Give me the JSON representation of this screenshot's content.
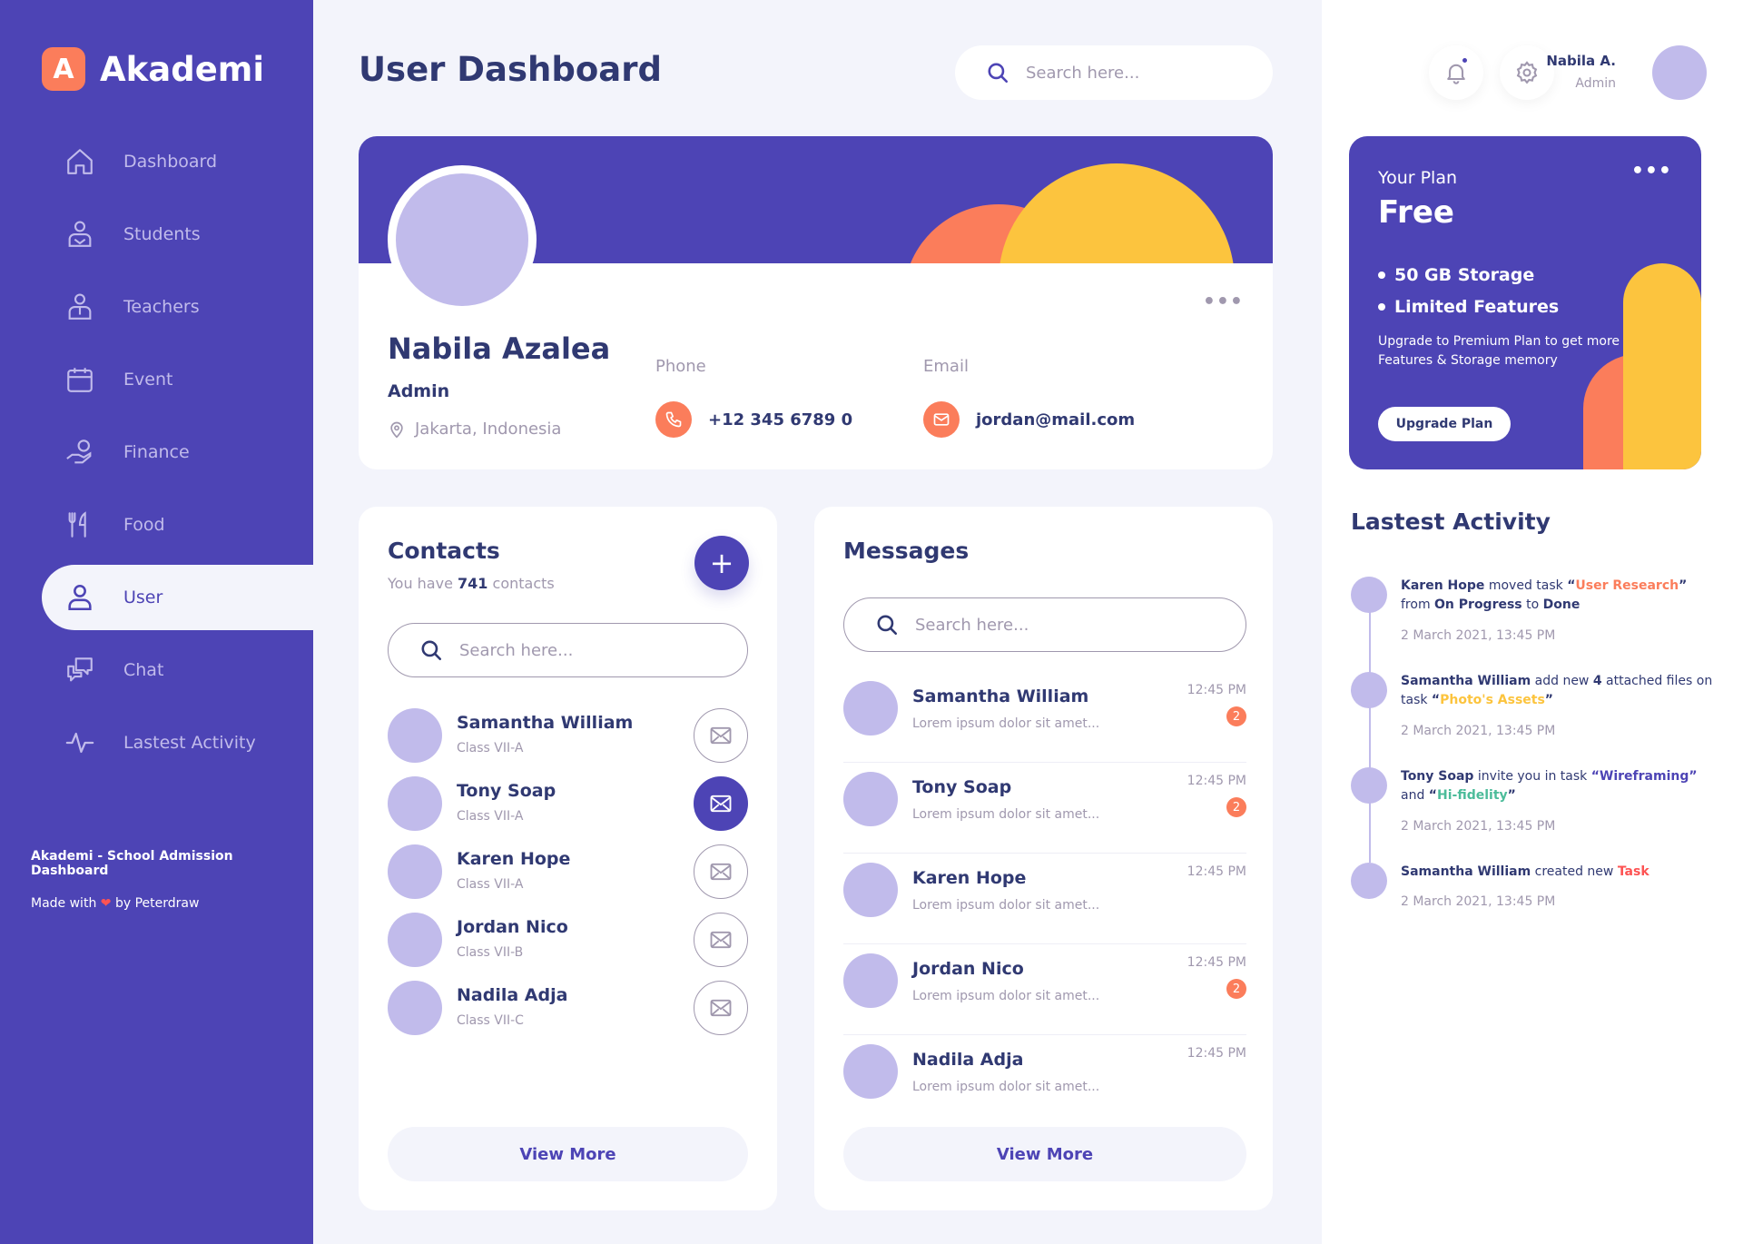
{
  "brand": {
    "badge": "A",
    "name": "Akademi",
    "colors": {
      "primary": "#4d44b5",
      "orange": "#fb7d5b",
      "yellow": "#fcc43e",
      "lavender": "#c1bbeb",
      "green": "#4cbc9a",
      "red": "#fd5353"
    }
  },
  "sidebar": {
    "items": [
      {
        "label": "Dashboard",
        "icon": "home-icon"
      },
      {
        "label": "Students",
        "icon": "student-icon"
      },
      {
        "label": "Teachers",
        "icon": "teacher-icon"
      },
      {
        "label": "Event",
        "icon": "calendar-icon"
      },
      {
        "label": "Finance",
        "icon": "finance-icon"
      },
      {
        "label": "Food",
        "icon": "food-icon"
      },
      {
        "label": "User",
        "icon": "user-icon",
        "active": true
      },
      {
        "label": "Chat",
        "icon": "chat-icon"
      },
      {
        "label": "Lastest Activity",
        "icon": "activity-icon"
      }
    ],
    "footer": {
      "title": "Akademi - School Admission Dashboard",
      "made_with": "Made with",
      "by": "by Peterdraw"
    }
  },
  "header": {
    "title": "User Dashboard",
    "search_placeholder": "Search here..."
  },
  "profile": {
    "name": "Nabila Azalea",
    "role": "Admin",
    "location": "Jakarta, Indonesia",
    "phone_label": "Phone",
    "phone": "+12 345 6789 0",
    "email_label": "Email",
    "email": "jordan@mail.com",
    "menu": "•••"
  },
  "contacts": {
    "title": "Contacts",
    "subtitle_pre": "You have",
    "count": "741",
    "subtitle_post": "contacts",
    "add": "+",
    "search_placeholder": "Search here...",
    "items": [
      {
        "name": "Samantha William",
        "class": "Class VII-A",
        "active": false
      },
      {
        "name": "Tony Soap",
        "class": "Class VII-A",
        "active": true
      },
      {
        "name": "Karen Hope",
        "class": "Class VII-A",
        "active": false
      },
      {
        "name": "Jordan Nico",
        "class": "Class VII-B",
        "active": false
      },
      {
        "name": "Nadila Adja",
        "class": "Class VII-C",
        "active": false
      }
    ],
    "view_more": "View More"
  },
  "messages": {
    "title": "Messages",
    "search_placeholder": "Search here...",
    "items": [
      {
        "name": "Samantha William",
        "text": "Lorem ipsum dolor sit amet...",
        "time": "12:45 PM",
        "badge": "2"
      },
      {
        "name": "Tony Soap",
        "text": "Lorem ipsum dolor sit amet...",
        "time": "12:45 PM",
        "badge": "2"
      },
      {
        "name": "Karen Hope",
        "text": "Lorem ipsum dolor sit amet...",
        "time": "12:45 PM",
        "badge": ""
      },
      {
        "name": "Jordan Nico",
        "text": "Lorem ipsum dolor sit amet...",
        "time": "12:45 PM",
        "badge": "2"
      },
      {
        "name": "Nadila Adja",
        "text": "Lorem ipsum dolor sit amet...",
        "time": "12:45 PM",
        "badge": ""
      }
    ],
    "view_more": "View More"
  },
  "user": {
    "name": "Nabila A.",
    "role": "Admin"
  },
  "plan": {
    "label": "Your Plan",
    "name": "Free",
    "features": [
      "50 GB Storage",
      "Limited Features"
    ],
    "description": "Upgrade to Premium Plan to get more Features & Storage memory",
    "button": "Upgrade Plan",
    "menu": "•••"
  },
  "activity": {
    "title": "Lastest Activity",
    "items": [
      {
        "time": "2 March 2021, 13:45 PM",
        "parts": [
          [
            "b",
            "Karen Hope"
          ],
          [
            "t",
            " moved task "
          ],
          [
            "b",
            "“"
          ],
          [
            "o",
            "User Research"
          ],
          [
            "b",
            "”"
          ],
          [
            "t",
            " from "
          ],
          [
            "b",
            "On Progress"
          ],
          [
            "t",
            " to "
          ],
          [
            "b",
            "Done"
          ]
        ]
      },
      {
        "time": "2 March 2021, 13:45 PM",
        "parts": [
          [
            "b",
            "Samantha William"
          ],
          [
            "t",
            " add new "
          ],
          [
            "b",
            "4"
          ],
          [
            "t",
            " attached files on task "
          ],
          [
            "b",
            "“"
          ],
          [
            "y",
            "Photo's Assets"
          ],
          [
            "b",
            "”"
          ]
        ]
      },
      {
        "time": "2 March 2021, 13:45 PM",
        "parts": [
          [
            "b",
            "Tony Soap"
          ],
          [
            "t",
            " invite you in task "
          ],
          [
            "p",
            "“Wireframing”"
          ],
          [
            "t",
            " and "
          ],
          [
            "b",
            "“"
          ],
          [
            "g",
            "Hi-fidelity"
          ],
          [
            "b",
            "”"
          ]
        ]
      },
      {
        "time": "2 March 2021, 13:45 PM",
        "parts": [
          [
            "b",
            "Samantha William"
          ],
          [
            "t",
            " created new "
          ],
          [
            "r",
            "Task"
          ]
        ]
      }
    ]
  }
}
